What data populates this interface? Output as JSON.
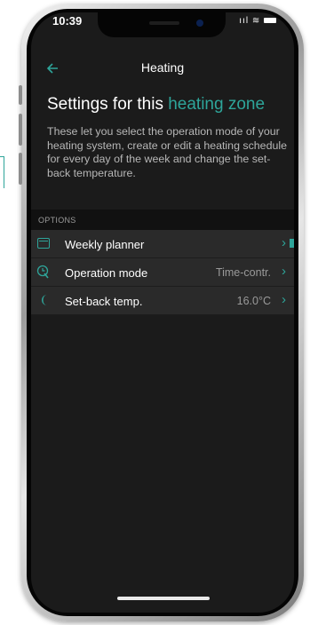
{
  "status_bar": {
    "time": "10:39",
    "icons": "ııl ᯤ"
  },
  "nav": {
    "back_icon": "back-arrow-icon",
    "title": "Heating"
  },
  "heading": {
    "prefix": "Settings for this ",
    "accent": "heating zone"
  },
  "description": "These let you select the operation mode of your heating system, create or edit a heating schedule for every day of the week and change the set-back temperature.",
  "options": {
    "label": "OPTIONS",
    "items": [
      {
        "icon": "calendar-icon",
        "label": "Weekly planner",
        "value": ""
      },
      {
        "icon": "clock-hand-icon",
        "label": "Operation mode",
        "value": "Time-contr."
      },
      {
        "icon": "moon-icon",
        "label": "Set-back temp.",
        "value": "16.0°C"
      }
    ]
  },
  "colors": {
    "accent": "#2ea59a",
    "background": "#1b1b1b",
    "row": "#2a2a2a"
  }
}
